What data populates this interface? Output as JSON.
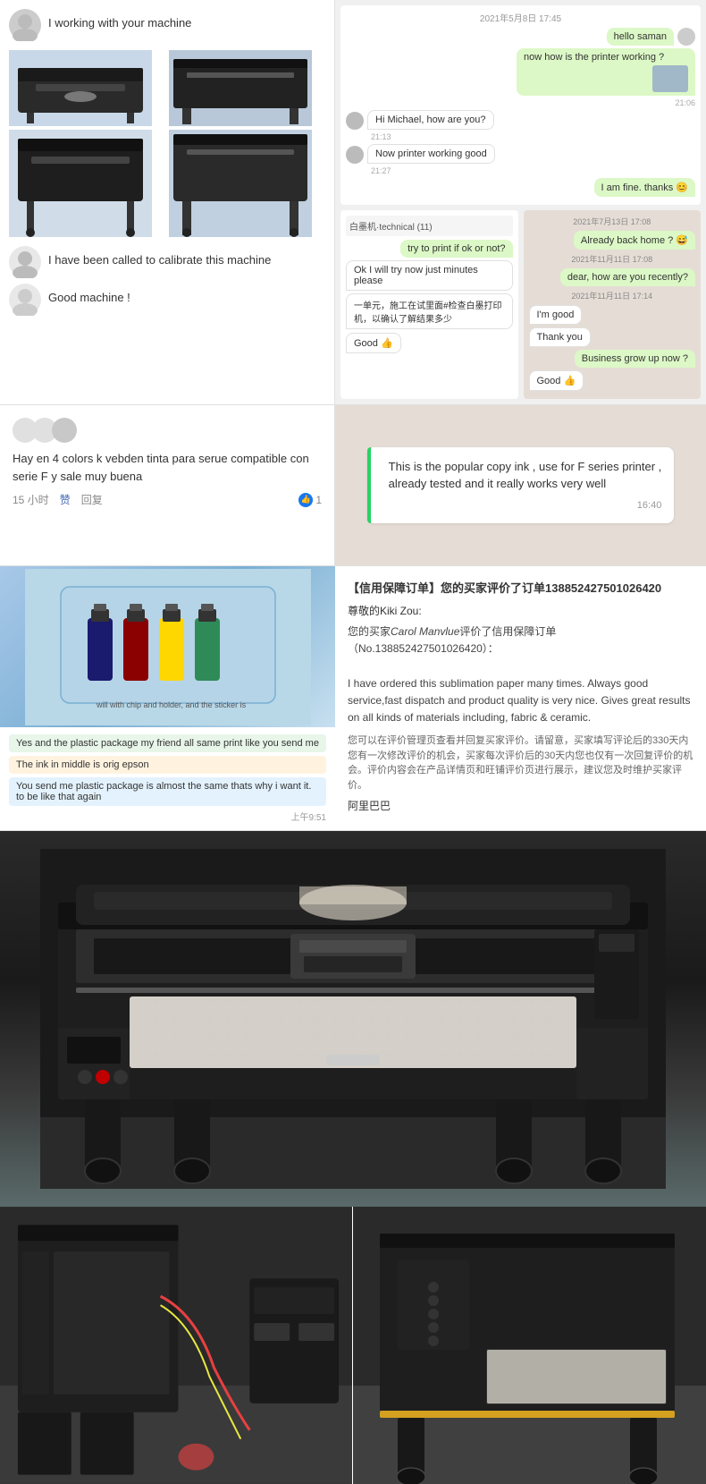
{
  "top_left": {
    "working_post_text": "I working with your machine",
    "calibrate_text": "I have been called to calibrate this machine",
    "good_machine_text": "Good machine !"
  },
  "chat_left": {
    "date1": "2021年5月8日 17:45",
    "msg1": "hello saman",
    "msg2": "now how is the printer working ?",
    "time1": "21:06",
    "msg3": "Hi Michael, how are you?",
    "time2": "21:13",
    "msg4": "Now printer working good",
    "time3": "21:27",
    "msg5": "I am fine. thanks 😊",
    "date2": "2021年7月13日 17:08",
    "msg6": "Already back home ? 😅",
    "date3": "2021年11月11日 17:08",
    "msg7": "dear, how are you recently?",
    "date4": "2021年11月11日 17:14",
    "msg8": "I'm good",
    "msg9": "Thank you",
    "msg10": "Business grow up now ?",
    "msg11": "Good 👍"
  },
  "chat_right_inner": {
    "label": "白墨机·technical (11)",
    "msg1": "try to print if ok or not?",
    "msg2": "Ok I will try now just minutes please",
    "msg3": "一单元，施工在试里面#检查白墨打印机，以确认了解结果多少",
    "msg4": "Good 👍",
    "msg5": "Good 👍"
  },
  "fb_review": {
    "text": "Hay en 4 colors k vebden tinta para serue compatible con serie F y sale muy buena",
    "time": "15 小时",
    "like": "赞",
    "reply": "回复",
    "count": "1"
  },
  "wa_message": {
    "line1": "This is the popular copy ink , use for F series printer ,",
    "line2": "already tested and it really works very well",
    "time": "16:40"
  },
  "order_review": {
    "title": "【信用保障订单】您的买家评价了订单13885242750102642​0",
    "salutation": "尊敬的Kiki Zou:",
    "body": "您的买家Carol Manvlue评价了信用保障订单（No.138852427501026420）：\n\nI have ordered this sublimation paper many times. Always good service,fast dispatch and product quality is very nice. Gives great results on all kinds of materials including, fabric & ceramic.",
    "note": "您可以在评价管理页查看并回复买家评价。请留意，买家填写评论后的330天内您有一次修改评价的机会，买家每次评价后的30天内您也仅有一次回复评价的机会。评价内容会在产品详情页和旺铺评价页进行展示，建议您及时维护买家评价。",
    "sign": "阿里巴巴"
  },
  "package_chat": {
    "label1": "will with chip and holder, and the sticker is",
    "msg1": "Yes and the plastic package my friend all same print like you send me",
    "msg2": "The ink in middle is orig epson",
    "msg3": "You send me plastic package is almost the same thats why i want it. to be like that again",
    "time": "上午9:51"
  },
  "labels": {
    "printer_alt": "Large format printer",
    "bottom_left_alt": "Printer left side view",
    "bottom_right_alt": "Printer right side view"
  }
}
